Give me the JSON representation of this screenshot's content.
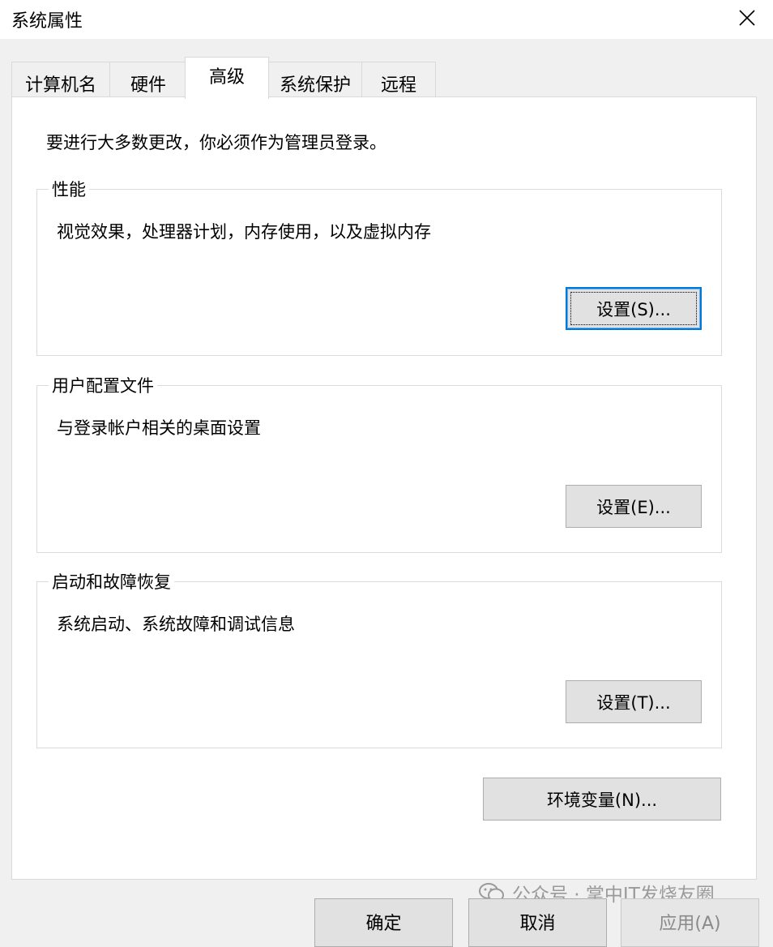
{
  "window": {
    "title": "系统属性"
  },
  "tabs": [
    {
      "label": "计算机名",
      "active": false
    },
    {
      "label": "硬件",
      "active": false
    },
    {
      "label": "高级",
      "active": true
    },
    {
      "label": "系统保护",
      "active": false
    },
    {
      "label": "远程",
      "active": false
    }
  ],
  "intro": "要进行大多数更改，你必须作为管理员登录。",
  "groups": {
    "performance": {
      "title": "性能",
      "desc": "视觉效果，处理器计划，内存使用，以及虚拟内存",
      "button": "设置(S)..."
    },
    "profiles": {
      "title": "用户配置文件",
      "desc": "与登录帐户相关的桌面设置",
      "button": "设置(E)..."
    },
    "startup": {
      "title": "启动和故障恢复",
      "desc": "系统启动、系统故障和调试信息",
      "button": "设置(T)..."
    }
  },
  "env_button": "环境变量(N)...",
  "footer": {
    "ok": "确定",
    "cancel": "取消",
    "apply": "应用(A)"
  },
  "watermark": "公众号 · 掌中IT发烧友圈",
  "colors": {
    "accent": "#0078d7",
    "panel": "#ffffff",
    "window": "#f0f0f0"
  }
}
